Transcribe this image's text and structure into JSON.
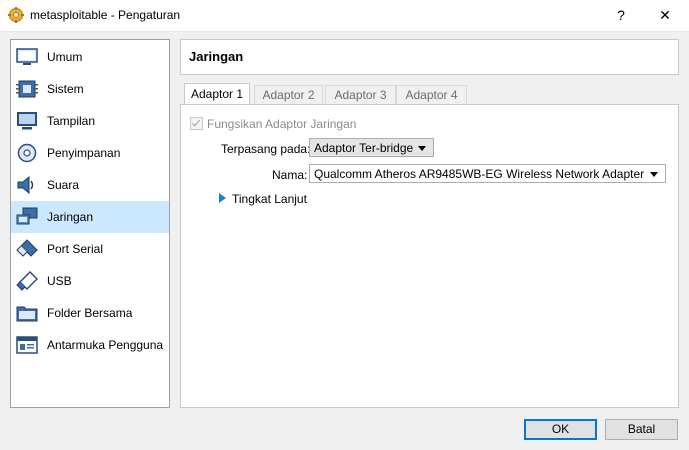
{
  "window": {
    "title": "metasploitable - Pengaturan",
    "help_label": "?",
    "close_label": "✕"
  },
  "sidebar": {
    "items": [
      {
        "label": "Umum",
        "icon": "monitor-icon"
      },
      {
        "label": "Sistem",
        "icon": "chip-icon"
      },
      {
        "label": "Tampilan",
        "icon": "display-icon"
      },
      {
        "label": "Penyimpanan",
        "icon": "storage-disk-icon"
      },
      {
        "label": "Suara",
        "icon": "speaker-icon"
      },
      {
        "label": "Jaringan",
        "icon": "network-icon",
        "selected": true
      },
      {
        "label": "Port Serial",
        "icon": "serial-port-icon"
      },
      {
        "label": "USB",
        "icon": "usb-icon"
      },
      {
        "label": "Folder Bersama",
        "icon": "shared-folder-icon"
      },
      {
        "label": "Antarmuka Pengguna",
        "icon": "user-interface-icon"
      }
    ]
  },
  "main": {
    "title": "Jaringan",
    "tabs": [
      {
        "label": "Adaptor 1",
        "active": true
      },
      {
        "label": "Adaptor 2"
      },
      {
        "label": "Adaptor 3"
      },
      {
        "label": "Adaptor 4"
      }
    ],
    "enable_label": "Fungsikan Adaptor Jaringan",
    "enable_checked": true,
    "attached_label": "Terpasang pada:",
    "attached_value": "Adaptor Ter-bridge",
    "name_label": "Nama:",
    "name_value": "Qualcomm Atheros AR9485WB-EG Wireless Network Adapter",
    "advanced_label": "Tingkat Lanjut"
  },
  "buttons": {
    "ok": "OK",
    "cancel": "Batal"
  },
  "colors": {
    "selection": "#cce8ff",
    "accent": "#0078d7"
  }
}
